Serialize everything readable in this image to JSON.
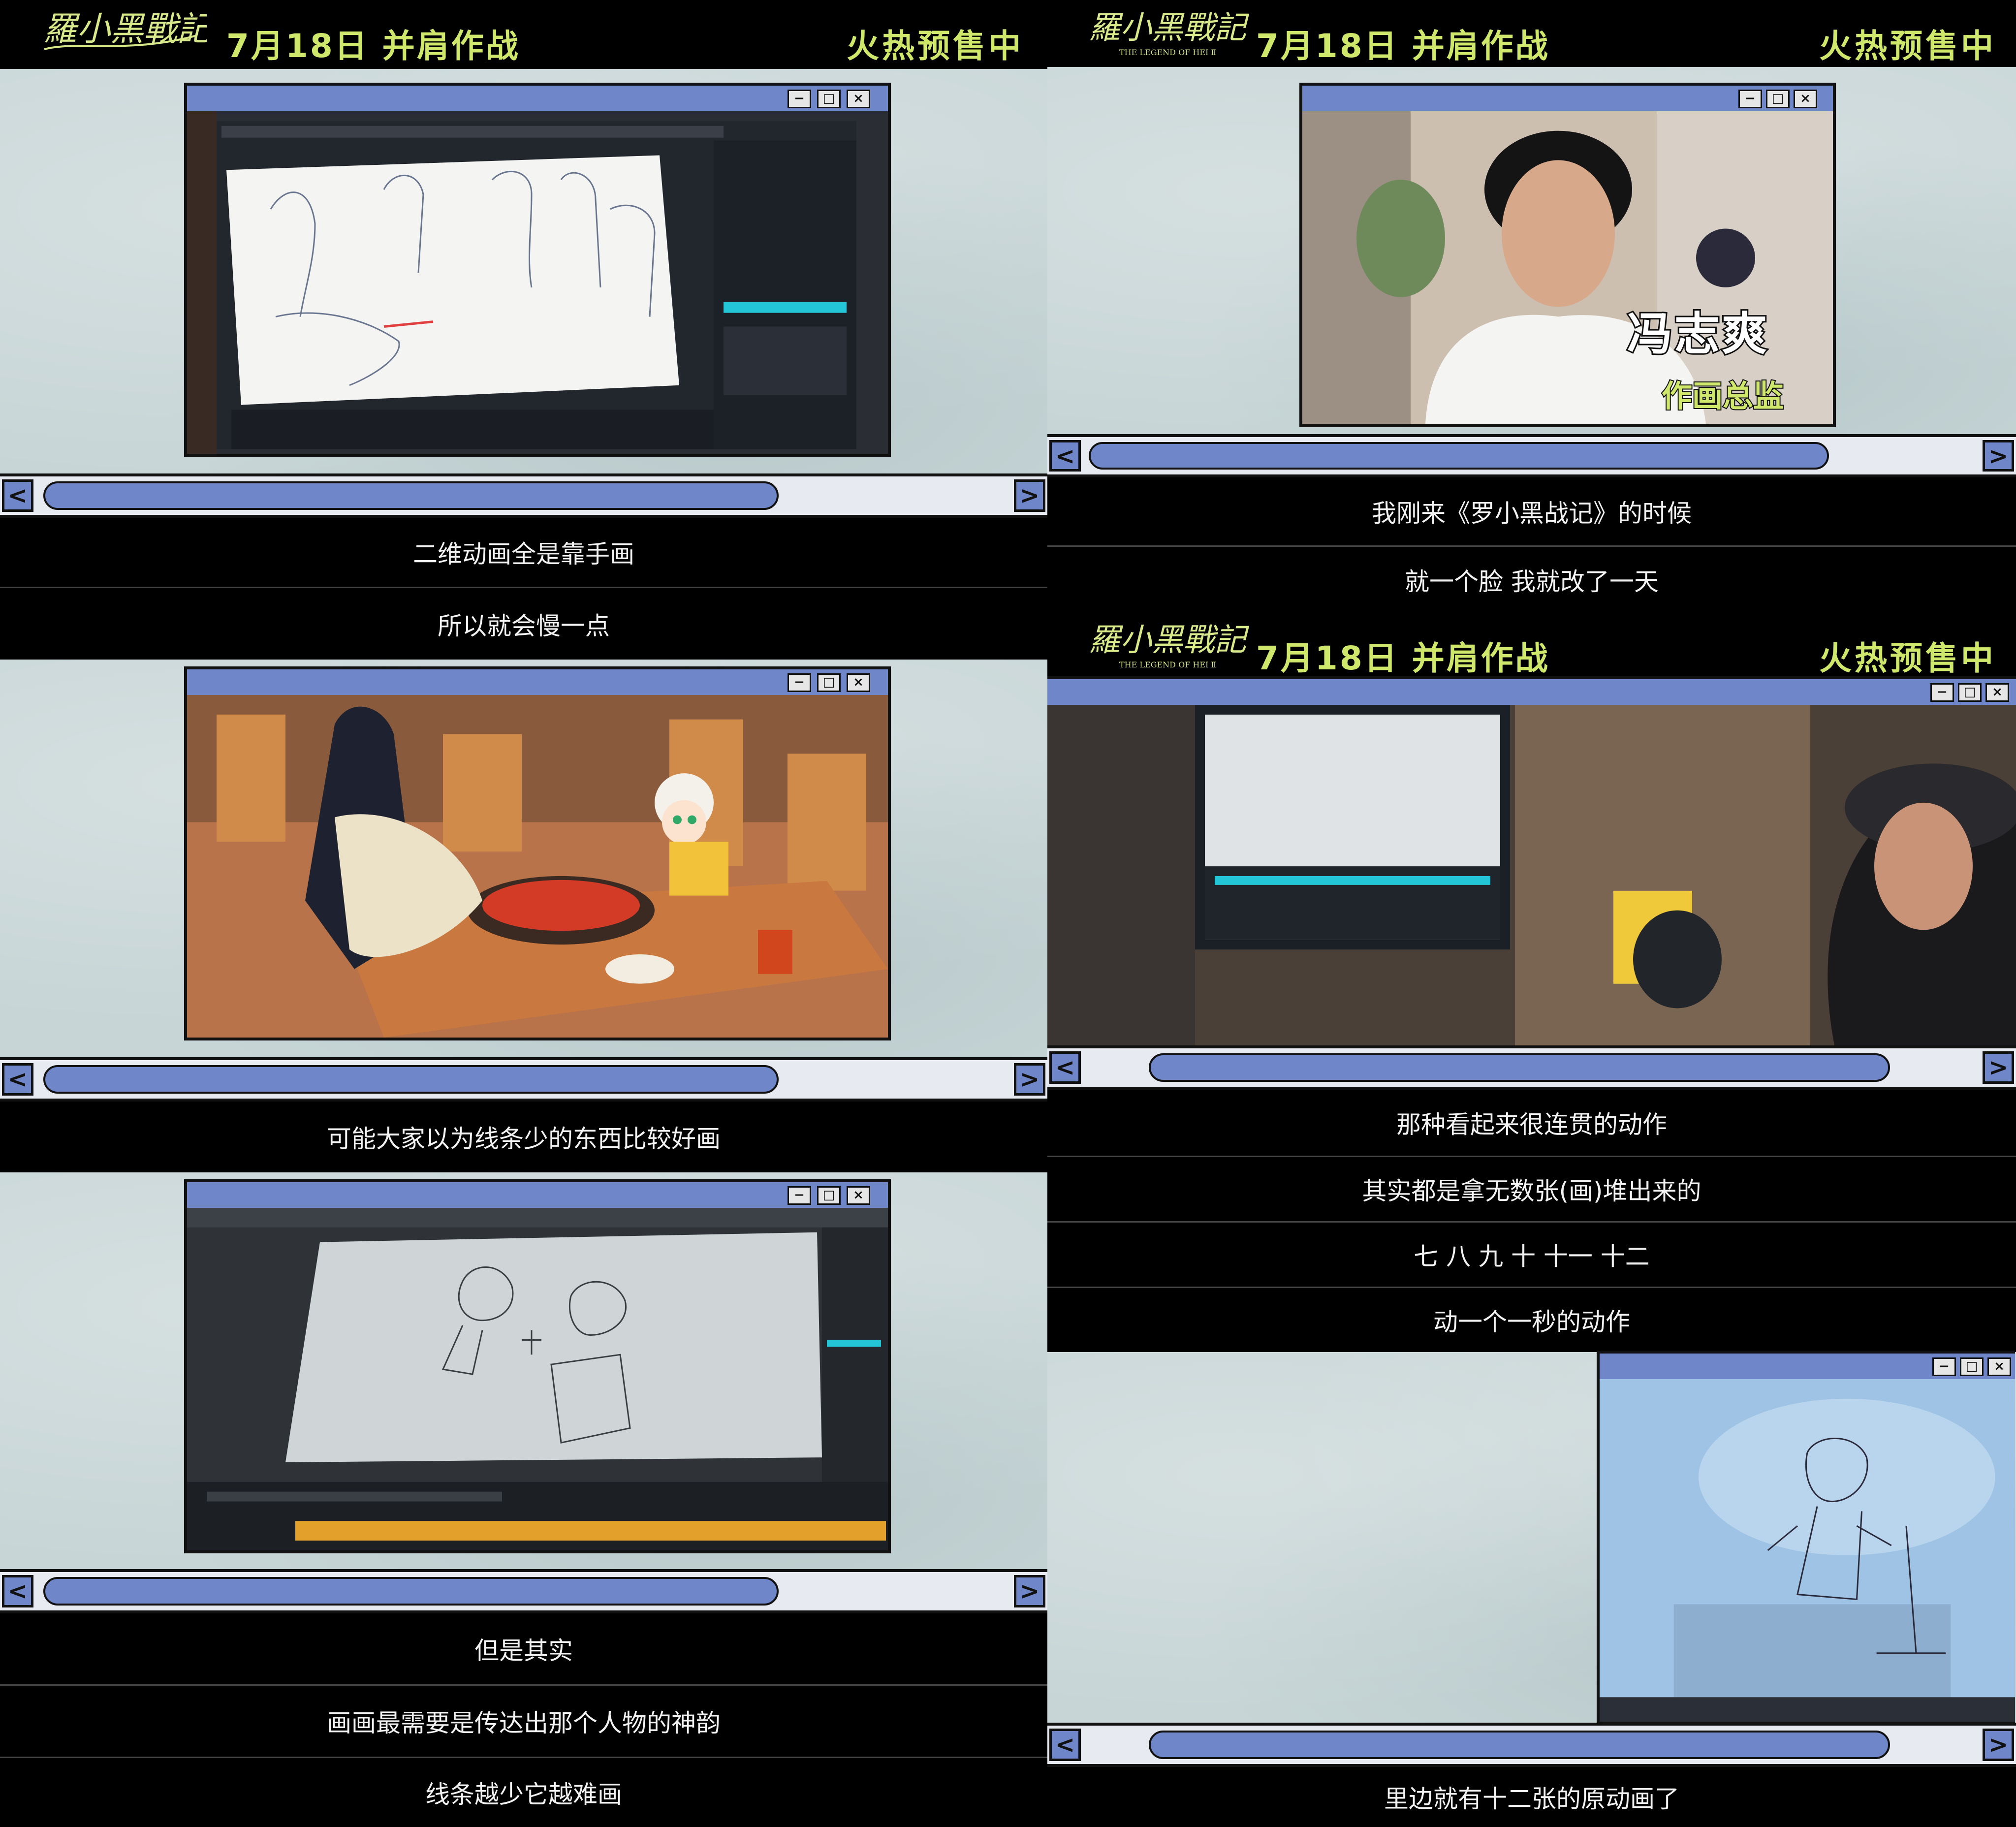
{
  "header": {
    "logo_text": "羅小黑戰記",
    "logo_sub": "THE LEGEND OF HEI Ⅱ",
    "release": "7月18日 并肩作战",
    "presale": "火热预售中"
  },
  "window_controls": {
    "minimize": "−",
    "maximize": "□",
    "close": "×"
  },
  "scroll_arrows": {
    "left": "<",
    "right": ">"
  },
  "interview": {
    "name": "冯志爽",
    "role": "作画总监"
  },
  "left": {
    "subtitles": [
      "二维动画全是靠手画",
      "所以就会慢一点",
      "可能大家以为线条少的东西比较好画",
      "但是其实",
      "画画最需要是传达出那个人物的神韵",
      "线条越少它越难画"
    ]
  },
  "right": {
    "subtitles": [
      "我刚来《罗小黑战记》的时候",
      "就一个脸 我就改了一天",
      "那种看起来很连贯的动作",
      "其实都是拿无数张(画)堆出来的",
      "七 八 九 十 十一 十二",
      "动一个一秒的动作",
      "里边就有十二张的原动画了"
    ]
  },
  "colors": {
    "accent": "#cfe76a",
    "window": "#6f86c9",
    "paper": "#c7d5d6"
  }
}
